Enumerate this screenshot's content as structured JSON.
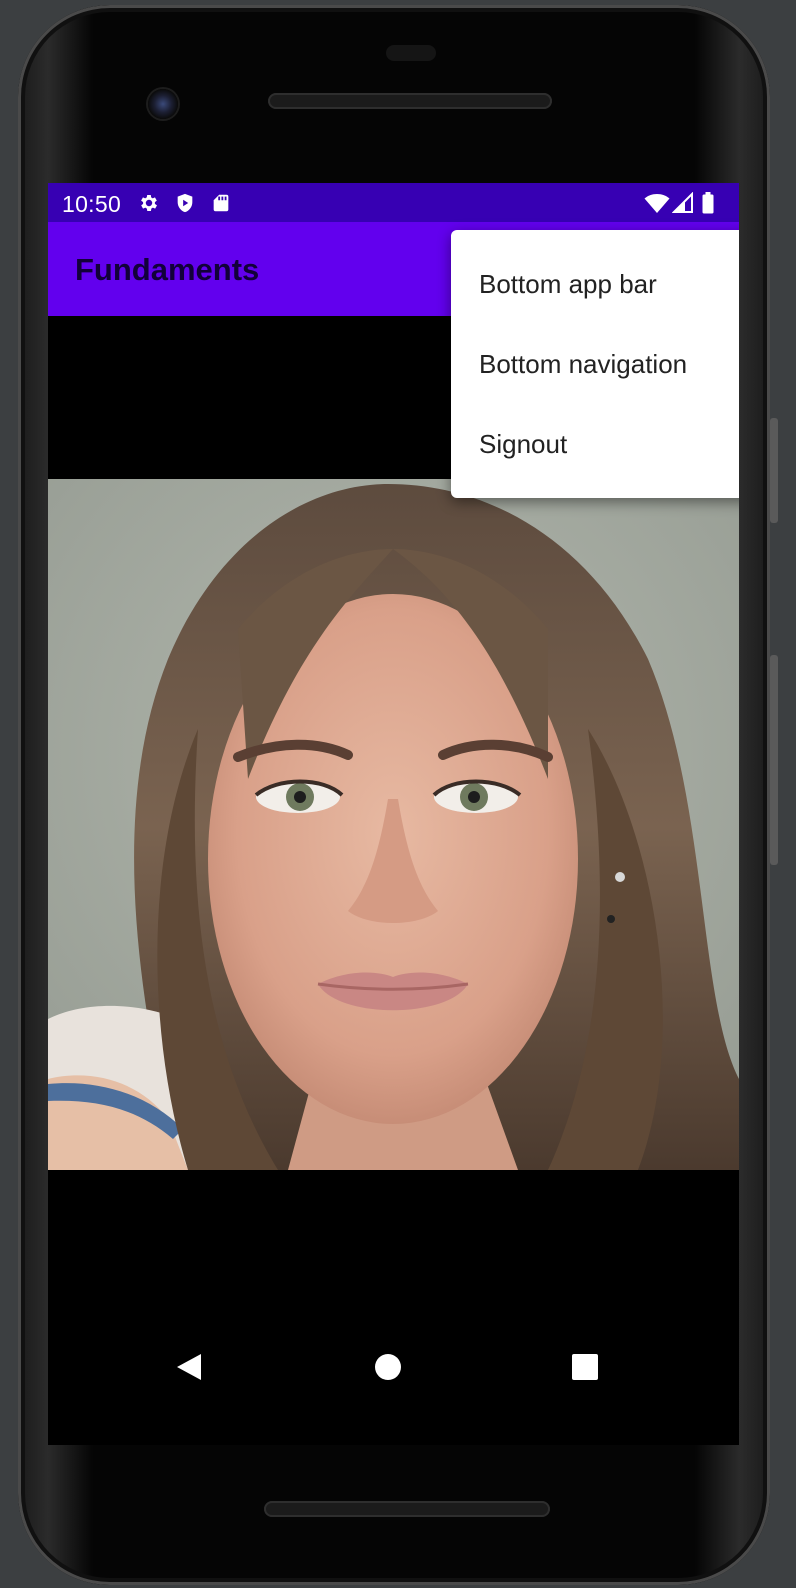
{
  "status_bar": {
    "time": "10:50",
    "left_icons": [
      "gear-icon",
      "shield-play-icon",
      "sd-card-icon"
    ],
    "right_icons": [
      "wifi-icon",
      "signal-icon",
      "battery-icon"
    ],
    "background": "#3700b3"
  },
  "app_bar": {
    "title": "Fundaments",
    "background": "#6200ee"
  },
  "overflow_menu": {
    "items": [
      {
        "label": "Bottom app bar"
      },
      {
        "label": "Bottom navigation"
      },
      {
        "label": "Signout"
      }
    ]
  },
  "content": {
    "image_alt": "portrait photo of a woman with long brown hair"
  },
  "nav_bar": {
    "buttons": [
      "back-icon",
      "home-icon",
      "recents-icon"
    ]
  }
}
